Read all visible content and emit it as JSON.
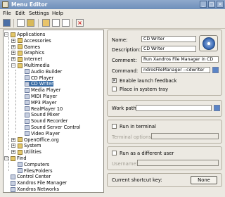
{
  "window": {
    "title": "Menu Editor",
    "controls": [
      "_",
      "□",
      "×"
    ]
  },
  "menubar": [
    "File",
    "Edit",
    "Settings",
    "Help"
  ],
  "tree": {
    "items": [
      {
        "label": "Applications",
        "level": 0,
        "expander": "−"
      },
      {
        "label": "Accessories",
        "level": 1,
        "expander": "+"
      },
      {
        "label": "Games",
        "level": 1,
        "expander": "+"
      },
      {
        "label": "Graphics",
        "level": 1,
        "expander": "+"
      },
      {
        "label": "Internet",
        "level": 1,
        "expander": "+"
      },
      {
        "label": "Multimedia",
        "level": 1,
        "expander": "−"
      },
      {
        "label": "Audio Builder",
        "level": 2
      },
      {
        "label": "CD Player",
        "level": 2
      },
      {
        "label": "CD Writer",
        "level": 2,
        "selected": true
      },
      {
        "label": "Media Player",
        "level": 2
      },
      {
        "label": "MIDI Player",
        "level": 2
      },
      {
        "label": "MP3 Player",
        "level": 2
      },
      {
        "label": "RealPlayer 10",
        "level": 2
      },
      {
        "label": "Sound Mixer",
        "level": 2
      },
      {
        "label": "Sound Recorder",
        "level": 2
      },
      {
        "label": "Sound Server Control",
        "level": 2
      },
      {
        "label": "Video Player",
        "level": 2
      },
      {
        "label": "OpenOffice.org",
        "level": 1,
        "expander": "+"
      },
      {
        "label": "System",
        "level": 1,
        "expander": "+"
      },
      {
        "label": "Utilities",
        "level": 1,
        "expander": "+"
      },
      {
        "label": "Find",
        "level": 0,
        "expander": "−"
      },
      {
        "label": "Computers",
        "level": 1
      },
      {
        "label": "Files/Folders",
        "level": 1
      },
      {
        "label": "Control Center",
        "level": 0
      },
      {
        "label": "Xandros File Manager",
        "level": 0
      },
      {
        "label": "Xandros Networks",
        "level": 0
      }
    ]
  },
  "form": {
    "name_label": "Name:",
    "name_value": "CD Writer",
    "description_label": "Description:",
    "description_value": "CD Writer",
    "comment_label": "Comment:",
    "comment_value": "Run Xandros File Manager in CD",
    "command_label": "Command:",
    "command_value": "ndrosFileManager --cdwriter",
    "launch_feedback_label": "Enable launch feedback",
    "launch_feedback_checked": true,
    "system_tray_label": "Place in system tray",
    "system_tray_checked": false,
    "work_path_label": "Work path:",
    "work_path_value": "",
    "run_terminal_label": "Run in terminal",
    "run_terminal_checked": false,
    "terminal_options_label": "Terminal options:",
    "run_different_user_label": "Run as a different user",
    "run_different_user_checked": false,
    "username_label": "Username:",
    "shortcut_label": "Current shortcut key:",
    "shortcut_button": "None"
  }
}
